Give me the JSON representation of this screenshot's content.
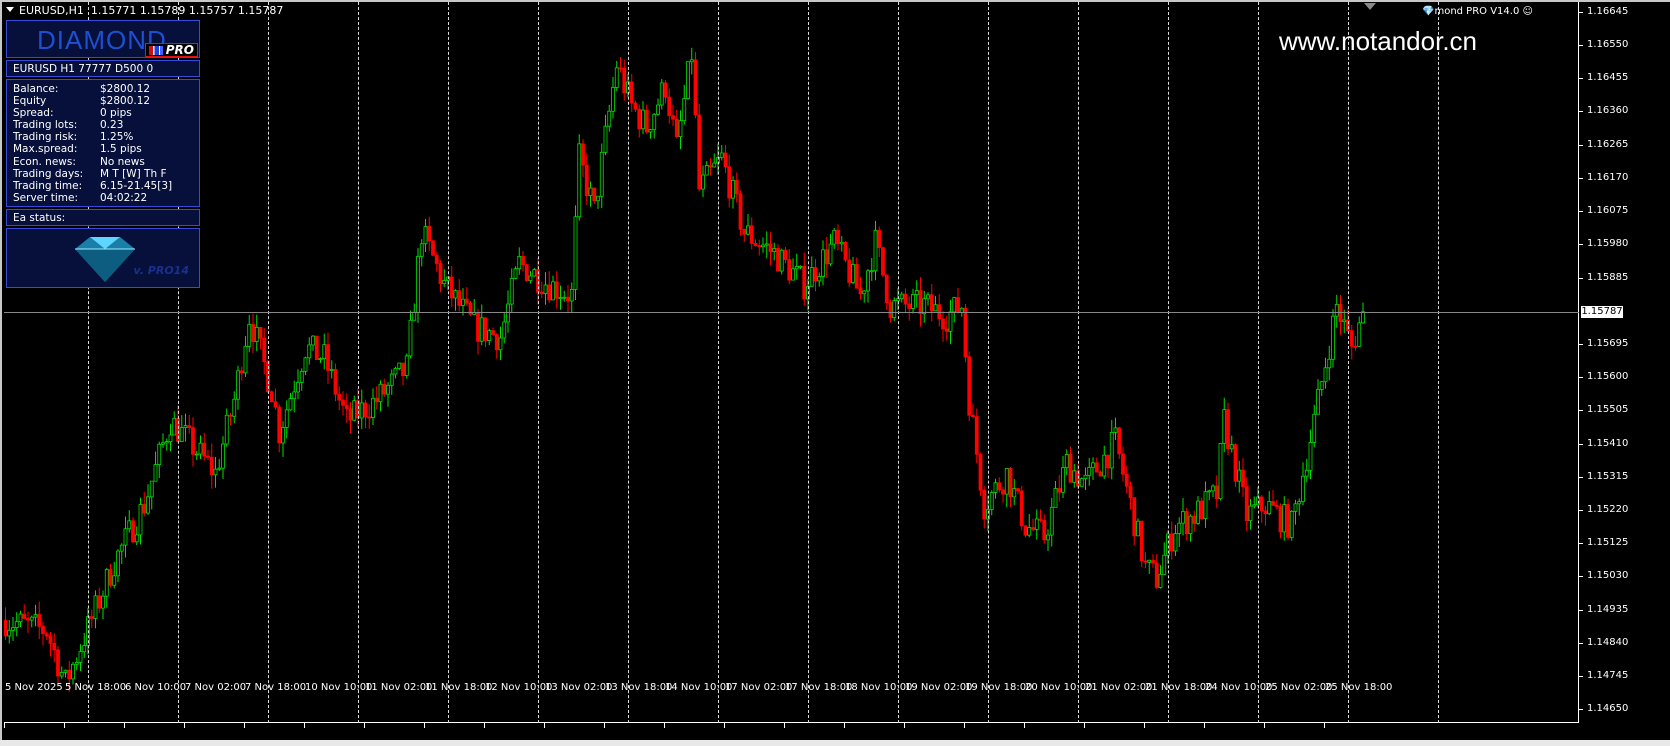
{
  "header": {
    "symbol": "EURUSD,H1",
    "open": "1.15771",
    "high": "1.15789",
    "low": "1.15757",
    "close": "1.15787"
  },
  "panel": {
    "logo_text": "DIAMOND",
    "logo_badge": "PRO",
    "symbol_line": "EURUSD H1 77777  D500 0",
    "rows": [
      {
        "k": "Balance:",
        "v": "$2800.12"
      },
      {
        "k": "Equity",
        "v": "$2800.12"
      },
      {
        "k": "Spread:",
        "v": "0 pips"
      },
      {
        "k": "Trading lots:",
        "v": "0.23"
      },
      {
        "k": "Trading risk:",
        "v": "1.25%"
      },
      {
        "k": "Max.spread:",
        "v": "1.5 pips"
      },
      {
        "k": "Econ. news:",
        "v": "No news"
      },
      {
        "k": "Trading days:",
        "v": "M T [W] Th F"
      },
      {
        "k": "Trading time:",
        "v": "6.15-21.45[3]"
      },
      {
        "k": "Server time:",
        "v": "04:02:22"
      }
    ],
    "status_label": "Ea status:",
    "version": "v. PRO14"
  },
  "ea_label": "mond PRO V14.0",
  "watermark": "www.notandor.cn",
  "current_price": "1.15787",
  "colors": {
    "bull": "#00e000",
    "bear": "#ff0000",
    "panel": "#06103a",
    "panel_border": "#3a4ad8"
  },
  "chart_data": {
    "type": "candlestick",
    "symbol": "EURUSD",
    "timeframe": "H1",
    "ylim": [
      1.14611,
      1.16673
    ],
    "y_ticks": [
      "1.16645",
      "1.16550",
      "1.16455",
      "1.16360",
      "1.16265",
      "1.16170",
      "1.16075",
      "1.15980",
      "1.15885",
      "1.15695",
      "1.15600",
      "1.15505",
      "1.15410",
      "1.15315",
      "1.15220",
      "1.15125",
      "1.15030",
      "1.14935",
      "1.14840",
      "1.14745",
      "1.14650"
    ],
    "x_ticks": [
      "5 Nov 2025",
      "5 Nov 18:00",
      "6 Nov 10:00",
      "7 Nov 02:00",
      "7 Nov 18:00",
      "10 Nov 10:00",
      "11 Nov 02:00",
      "11 Nov 18:00",
      "12 Nov 10:00",
      "13 Nov 02:00",
      "13 Nov 18:00",
      "14 Nov 10:00",
      "17 Nov 02:00",
      "17 Nov 18:00",
      "18 Nov 10:00",
      "19 Nov 02:00",
      "19 Nov 18:00",
      "20 Nov 10:00",
      "21 Nov 02:00",
      "21 Nov 18:00",
      "24 Nov 10:00",
      "25 Nov 02:00",
      "25 Nov 18:00"
    ],
    "bars": 363,
    "close_path": [
      [
        0,
        1.14905
      ],
      [
        11,
        1.14875
      ],
      [
        16,
        1.14725
      ],
      [
        24,
        1.14935
      ],
      [
        29,
        1.1507
      ],
      [
        37,
        1.15235
      ],
      [
        44,
        1.15475
      ],
      [
        49,
        1.15415
      ],
      [
        56,
        1.15325
      ],
      [
        61,
        1.15535
      ],
      [
        65,
        1.15775
      ],
      [
        71,
        1.15565
      ],
      [
        73,
        1.15445
      ],
      [
        80,
        1.15685
      ],
      [
        85,
        1.15655
      ],
      [
        91,
        1.15475
      ],
      [
        99,
        1.15535
      ],
      [
        107,
        1.15625
      ],
      [
        111,
        1.16015
      ],
      [
        117,
        1.15865
      ],
      [
        125,
        1.15745
      ],
      [
        132,
        1.15715
      ],
      [
        137,
        1.15925
      ],
      [
        145,
        1.15865
      ],
      [
        151,
        1.15835
      ],
      [
        153,
        1.16225
      ],
      [
        157,
        1.16075
      ],
      [
        163,
        1.16495
      ],
      [
        167,
        1.16375
      ],
      [
        171,
        1.16315
      ],
      [
        176,
        1.16435
      ],
      [
        179,
        1.16255
      ],
      [
        183,
        1.16525
      ],
      [
        185,
        1.16135
      ],
      [
        191,
        1.16225
      ],
      [
        197,
        1.16015
      ],
      [
        205,
        1.15955
      ],
      [
        213,
        1.15865
      ],
      [
        221,
        1.15985
      ],
      [
        228,
        1.15835
      ],
      [
        232,
        1.15985
      ],
      [
        236,
        1.15805
      ],
      [
        245,
        1.15805
      ],
      [
        251,
        1.15775
      ],
      [
        255,
        1.15805
      ],
      [
        257,
        1.15535
      ],
      [
        261,
        1.15235
      ],
      [
        267,
        1.15325
      ],
      [
        272,
        1.15175
      ],
      [
        277,
        1.15145
      ],
      [
        283,
        1.15355
      ],
      [
        288,
        1.15295
      ],
      [
        296,
        1.15415
      ],
      [
        300,
        1.15235
      ],
      [
        304,
        1.15055
      ],
      [
        307,
        1.15025
      ],
      [
        312,
        1.15175
      ],
      [
        317,
        1.15205
      ],
      [
        323,
        1.15265
      ],
      [
        325,
        1.15475
      ],
      [
        331,
        1.15205
      ],
      [
        336,
        1.15235
      ],
      [
        343,
        1.15175
      ],
      [
        349,
        1.15475
      ],
      [
        355,
        1.15805
      ],
      [
        359,
        1.15685
      ],
      [
        362,
        1.15787
      ]
    ]
  }
}
